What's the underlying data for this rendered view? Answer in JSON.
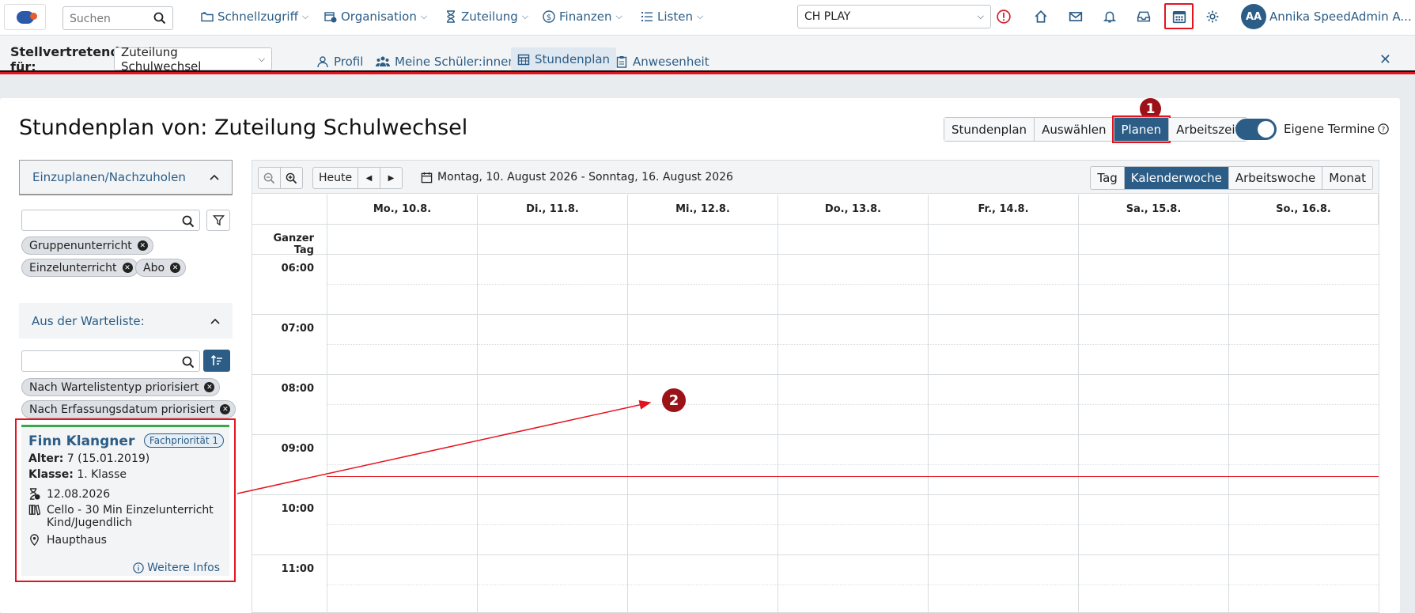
{
  "topbar": {
    "search_placeholder": "Suchen",
    "nav": [
      {
        "label": "Schnellzugriff",
        "icon": "folder-icon"
      },
      {
        "label": "Organisation",
        "icon": "calendar-clock-icon"
      },
      {
        "label": "Zuteilung",
        "icon": "hourglass-icon"
      },
      {
        "label": "Finanzen",
        "icon": "dollar-icon"
      },
      {
        "label": "Listen",
        "icon": "list-icon"
      }
    ],
    "location": "CH PLAY",
    "avatar_initials": "AA",
    "user_name": "Annika SpeedAdmin A..."
  },
  "subbar": {
    "label": "Stellvertretend für:",
    "selected": "Zuteilung Schulwechsel",
    "tabs": [
      {
        "label": "Profil",
        "icon": "person-icon"
      },
      {
        "label": "Meine Schüler:innen",
        "icon": "people-icon"
      },
      {
        "label": "Stundenplan",
        "icon": "calendar-icon"
      },
      {
        "label": "Anwesenheit",
        "icon": "clipboard-icon"
      }
    ],
    "active_tab": "Stundenplan"
  },
  "page": {
    "title": "Stundenplan von: Zuteilung Schulwechsel",
    "views": [
      "Stundenplan",
      "Auswählen",
      "Planen",
      "Arbeitszeit"
    ],
    "active_view": "Planen",
    "badge_1": "1",
    "badge_2": "2",
    "toggle_label": "Eigene Termine",
    "toggle_on": true
  },
  "left_panel": {
    "section1": "Einzuplanen/Nachzuholen",
    "chips1": [
      "Gruppenunterricht",
      "Einzelunterricht",
      "Abo"
    ],
    "section2": "Aus der Warteliste:",
    "chips2": [
      "Nach Wartelistentyp priorisiert",
      "Nach Erfassungsdatum priorisiert"
    ]
  },
  "student": {
    "name": "Finn Klangner",
    "priority": "Fachpriorität 1",
    "age_label": "Alter:",
    "age_value": "7 (15.01.2019)",
    "class_label": "Klasse:",
    "class_value": "1. Klasse",
    "date": "12.08.2026",
    "course_line1": "Cello - 30 Min Einzelunterricht",
    "course_line2": "Kind/Jugendlich",
    "location": "Haupthaus",
    "more_info": "Weitere Infos"
  },
  "calendar": {
    "today": "Heute",
    "date_range": "Montag, 10. August 2026 - Sonntag, 16. August 2026",
    "ranges": [
      "Tag",
      "Kalenderwoche",
      "Arbeitswoche",
      "Monat"
    ],
    "active_range": "Kalenderwoche",
    "days": [
      "Mo., 10.8.",
      "Di., 11.8.",
      "Mi., 12.8.",
      "Do., 13.8.",
      "Fr., 14.8.",
      "Sa., 15.8.",
      "So., 16.8."
    ],
    "all_day_label": "Ganzer Tag",
    "hours": [
      "06:00",
      "07:00",
      "08:00",
      "09:00",
      "10:00",
      "11:00"
    ]
  },
  "colors": {
    "brand": "#2c5d86",
    "highlight_red": "#e4141f",
    "badge_dark_red": "#9b1218",
    "priority_green": "#3aa84a"
  }
}
